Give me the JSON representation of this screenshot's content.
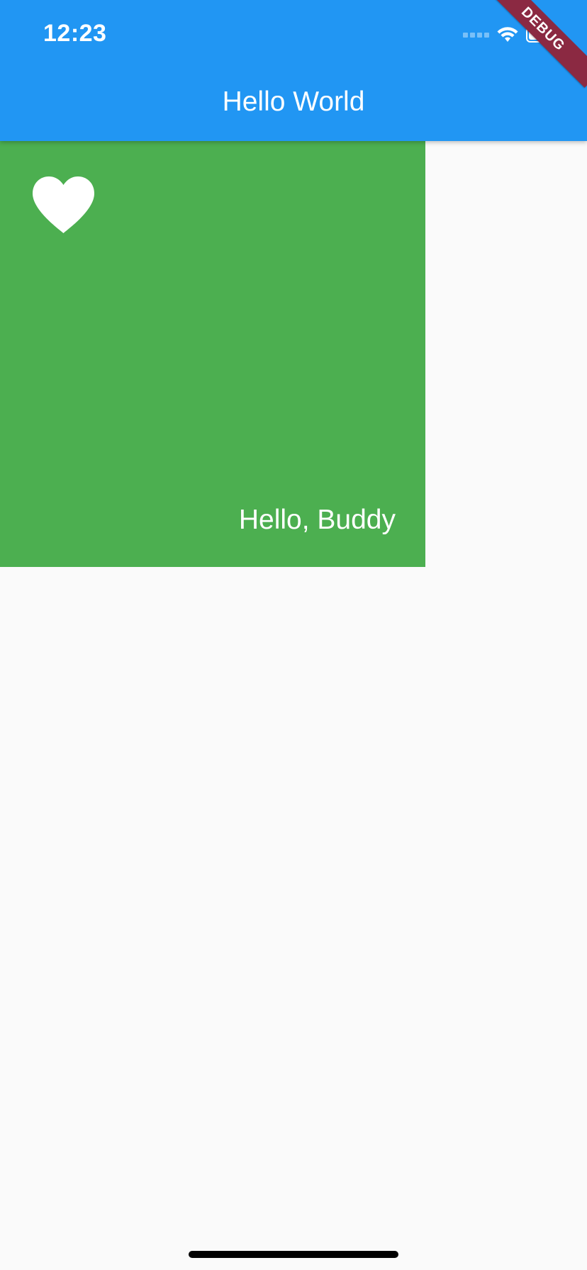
{
  "status_bar": {
    "time": "12:23"
  },
  "app_bar": {
    "title": "Hello World",
    "debug_banner": "DEBUG"
  },
  "card": {
    "text": "Hello, Buddy",
    "icon": "heart-icon"
  },
  "colors": {
    "app_bar": "#2196F3",
    "card": "#4CAF50",
    "background": "#FAFAFA",
    "debug_banner": "#8B2942"
  }
}
